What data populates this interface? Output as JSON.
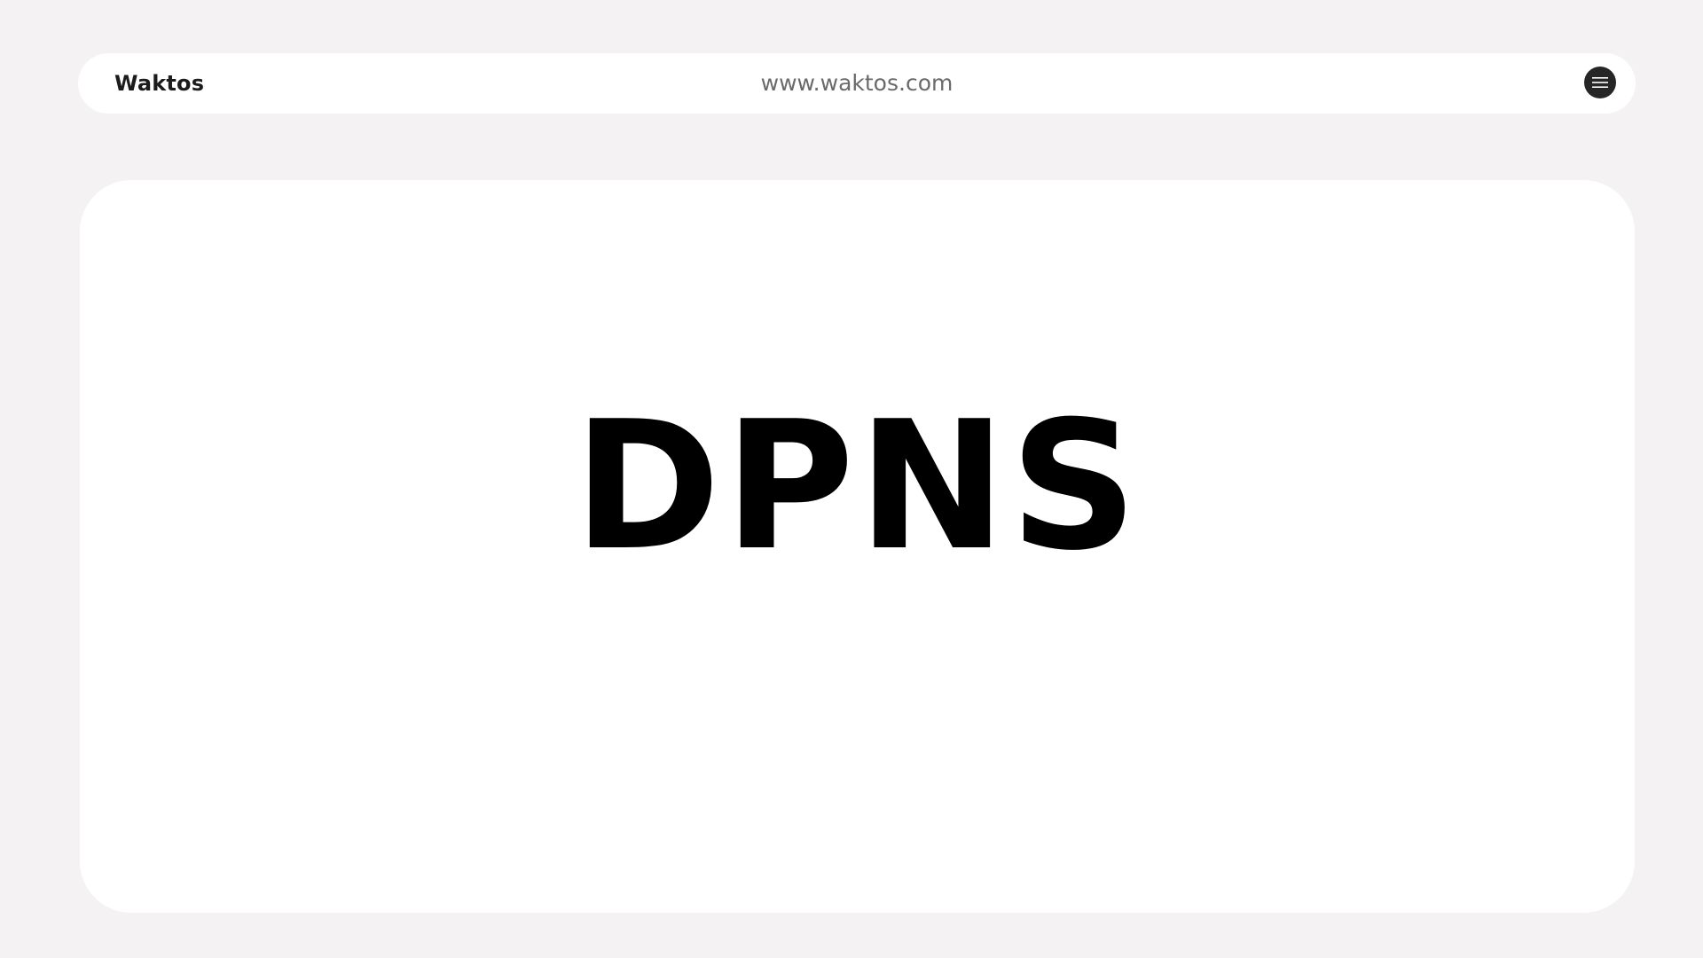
{
  "header": {
    "brand": "Waktos",
    "url": "www.waktos.com",
    "menu_icon": "hamburger-menu-icon"
  },
  "main": {
    "headline": "DPNS"
  },
  "colors": {
    "page_background": "#f4f2f3",
    "surface": "#ffffff",
    "text_primary": "#000000",
    "text_muted": "#6a6a6a",
    "menu_button": "#262626"
  }
}
